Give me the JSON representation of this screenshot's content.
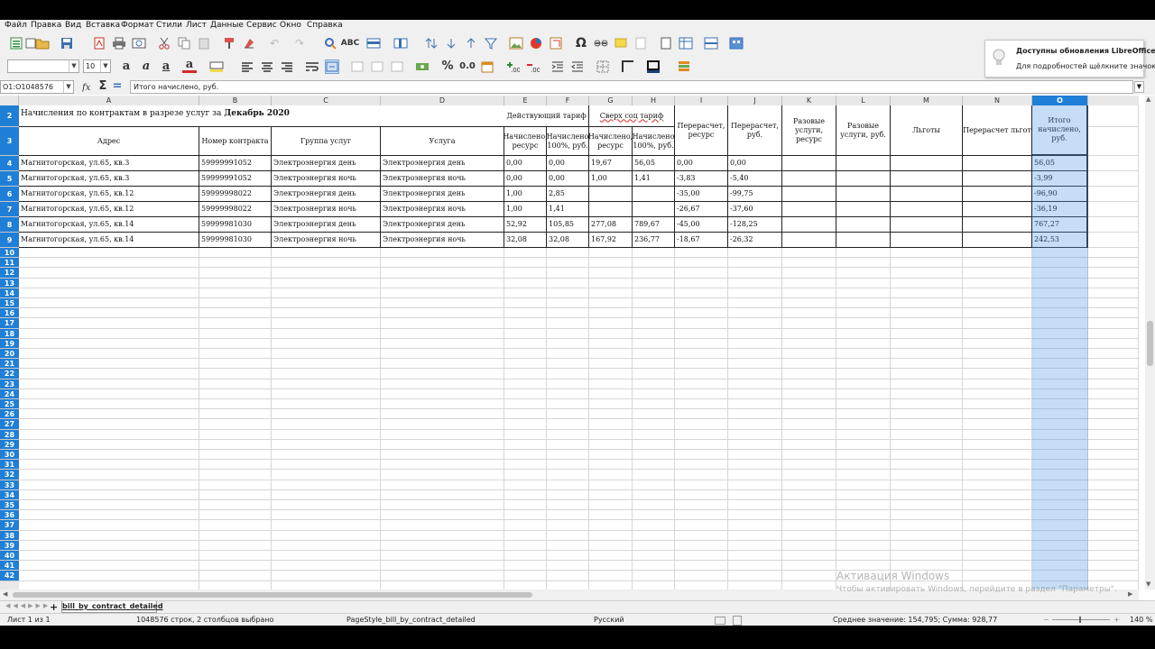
{
  "menu": [
    "Файл",
    "Правка",
    "Вид",
    "Вставка",
    "Формат",
    "Стили",
    "Лист",
    "Данные",
    "Сервис",
    "Окно",
    "Справка"
  ],
  "toolbar": {
    "font_name": "",
    "font_size": "10",
    "percent_icon": "%",
    "number_format": "0.0",
    "omega_icon": "Ω"
  },
  "notification": {
    "title": "Доступны обновления LibreOffice",
    "body": "Для подробностей щёлкните значок."
  },
  "formula_bar": {
    "name_box": "O1:O1048576",
    "sum_icon": "Σ",
    "equals_icon": "=",
    "content": "Итого начислено, руб."
  },
  "columns": [
    "A",
    "B",
    "C",
    "D",
    "E",
    "F",
    "G",
    "H",
    "I",
    "J",
    "K",
    "L",
    "M",
    "N",
    "O"
  ],
  "selected_column": "O",
  "sheet": {
    "title_prefix": "Начисления по контрактам в разрезе услуг за ",
    "title_period": "Декабрь 2020",
    "headers": {
      "address": "Адрес",
      "contract": "Номер контракта",
      "group": "Группа услуг",
      "service": "Услуга",
      "tariff": "Действующий тариф",
      "over": "Сверх соц тариф",
      "accrued_resource": "Начислено, ресурс",
      "accrued_100": "Начислено 100%, руб.",
      "accrued_resource_2": "Начислено, ресурс",
      "accrued_100_2": "Начислено 100%, руб.",
      "recalc_resource": "Перерасчет, ресурс",
      "recalc_rub": "Перерасчет, руб.",
      "onetime_resource": "Разовые услуги, ресурс",
      "onetime_rub": "Разовые услуги, руб.",
      "benefits": "Льготы",
      "benefit_recalc": "Перерасчет льгот",
      "total": "Итого начислено, руб."
    },
    "rows": [
      [
        "Магнитогорская, ул.65, кв.3",
        "59999991052",
        "Электроэнергия день",
        "Электроэнергия день",
        "0,00",
        "0,00",
        "19,67",
        "56,05",
        "0,00",
        "0,00",
        "",
        "",
        "",
        "",
        "56,05"
      ],
      [
        "Магнитогорская, ул.65, кв.3",
        "59999991052",
        "Электроэнергия ночь",
        "Электроэнергия ночь",
        "0,00",
        "0,00",
        "1,00",
        "1,41",
        "-3,83",
        "-5,40",
        "",
        "",
        "",
        "",
        "-3,99"
      ],
      [
        "Магнитогорская, ул.65, кв.12",
        "59999998022",
        "Электроэнергия день",
        "Электроэнергия день",
        "1,00",
        "2,85",
        "",
        "",
        "-35,00",
        "-99,75",
        "",
        "",
        "",
        "",
        "-96,90"
      ],
      [
        "Магнитогорская, ул.65, кв.12",
        "59999998022",
        "Электроэнергия ночь",
        "Электроэнергия ночь",
        "1,00",
        "1,41",
        "",
        "",
        "-26,67",
        "-37,60",
        "",
        "",
        "",
        "",
        "-36,19"
      ],
      [
        "Магнитогорская, ул.65, кв.14",
        "59999981030",
        "Электроэнергия день",
        "Электроэнергия день",
        "52,92",
        "105,85",
        "277,08",
        "789,67",
        "-45,00",
        "-128,25",
        "",
        "",
        "",
        "",
        "767,27"
      ],
      [
        "Магнитогорская, ул.65, кв.14",
        "59999981030",
        "Электроэнергия ночь",
        "Электроэнергия ночь",
        "32,08",
        "32,08",
        "167,92",
        "236,77",
        "-18,67",
        "-26,32",
        "",
        "",
        "",
        "",
        "242,53"
      ]
    ]
  },
  "row_numbers": [
    "2",
    "3",
    "4",
    "5",
    "6",
    "7",
    "8",
    "9",
    "10",
    "11",
    "12",
    "13",
    "14",
    "15",
    "16",
    "17",
    "18",
    "19",
    "20",
    "21",
    "22",
    "23",
    "24",
    "25",
    "26",
    "27",
    "28",
    "29",
    "30",
    "31",
    "32",
    "33",
    "34",
    "35",
    "36",
    "37",
    "38",
    "39",
    "40",
    "41",
    "42"
  ],
  "sheet_tab": {
    "add_label": "+",
    "name": "bill_by_contract_detailed"
  },
  "status": {
    "sheet": "Лист 1 из 1",
    "selection": "1048576 строк, 2 столбцов выбрано",
    "page_style": "PageStyle_bill_by_contract_detailed",
    "language": "Русский",
    "summary": "Среднее значение: 154,795; Сумма: 928,77",
    "zoom": "140 %"
  },
  "watermark": {
    "title": "Активация Windows",
    "body": "Чтобы активировать Windows, перейдите в раздел \"Параметры\"."
  },
  "colors": {
    "selection_blue": "#1f7fd6",
    "selection_fill": "#4c96e2",
    "toolbar_bg": "#f0f0f0"
  }
}
